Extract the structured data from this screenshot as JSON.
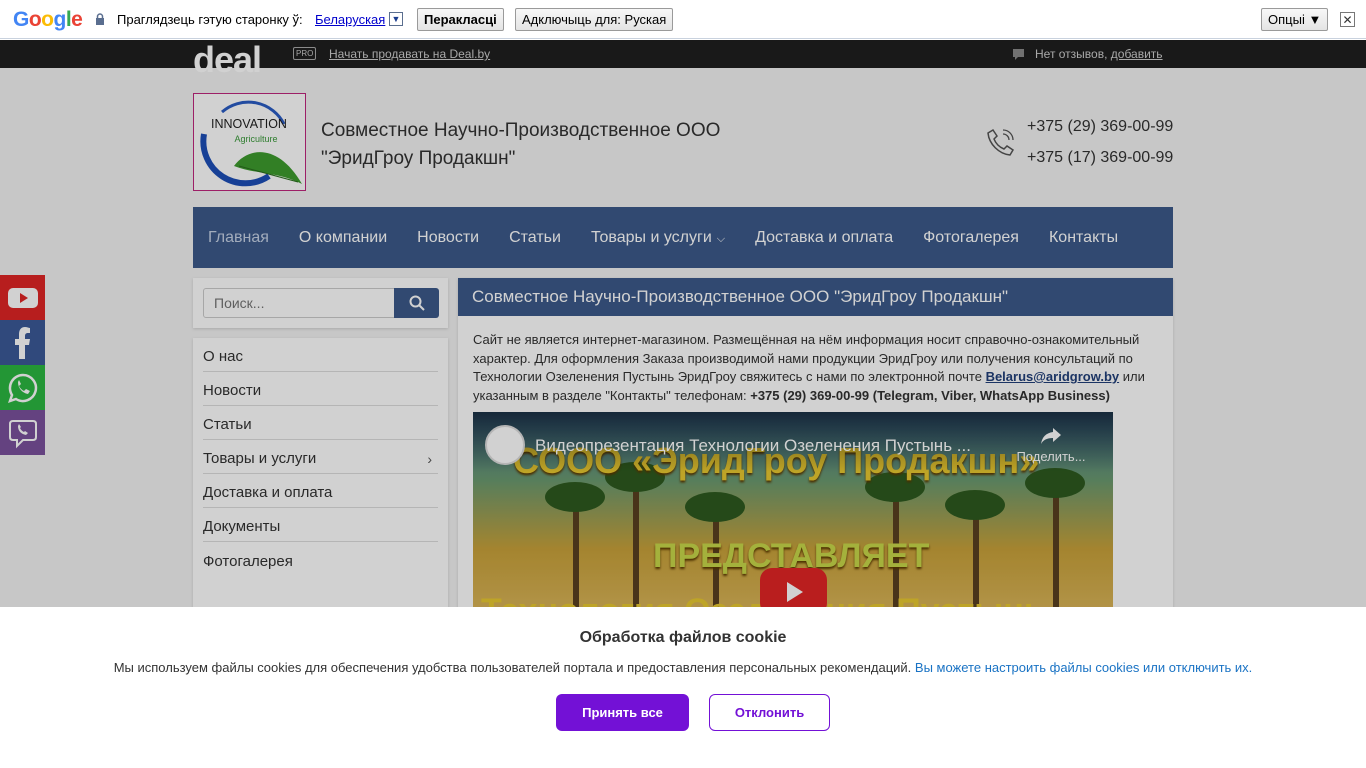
{
  "translate_bar": {
    "logo": "Google",
    "prompt": "Праглядзець гэтую старонку ў:",
    "language": "Беларуская",
    "language_arrow": "▼",
    "translate_button": "Перакласці",
    "disable_button": "Адключыць для: Руская",
    "options_button": "Опцыі ▼",
    "close": "✕"
  },
  "topbar": {
    "logo": "deal",
    "pro_badge": "PRO",
    "sell_link": "Начать продавать на Deal.by",
    "reviews_text": "Нет отзывов, ",
    "reviews_add": "добавить"
  },
  "header": {
    "logo_text_top": "INNOVATION",
    "logo_text_sub": "Agriculture",
    "company_name": "Совместное Научно-Производственное ООО \"ЭридГроу Продакшн\"",
    "phone1": "+375 (29) 369-00-99",
    "phone2": "+375 (17) 369-00-99"
  },
  "nav": {
    "items": [
      {
        "label": "Главная"
      },
      {
        "label": "О компании"
      },
      {
        "label": "Новости"
      },
      {
        "label": "Статьи"
      },
      {
        "label": "Товары и услуги"
      },
      {
        "label": "Доставка и оплата"
      },
      {
        "label": "Фотогалерея"
      },
      {
        "label": "Контакты"
      }
    ]
  },
  "search": {
    "placeholder": "Поиск..."
  },
  "sidebar": {
    "items": [
      {
        "label": "О нас"
      },
      {
        "label": "Новости"
      },
      {
        "label": "Статьи"
      },
      {
        "label": "Товары и услуги"
      },
      {
        "label": "Доставка и оплата"
      },
      {
        "label": "Документы"
      },
      {
        "label": "Фотогалерея"
      }
    ]
  },
  "content": {
    "heading": "Совместное Научно-Производственное ООО \"ЭридГроу Продакшн\"",
    "text_part1": "Сайт не является интернет-магазином. Размещённая на нём информация носит справочно-ознакомительный характер. Для оформления Заказа производимой нами продукции ЭридГроу или получения консультаций по Технологии Озеленения Пустынь ЭридГроу свяжитесь с нами по электронной почте ",
    "email": "Belarus@aridgrow.by",
    "text_part2": " или указанным в разделе \"Контакты\" телефонам: ",
    "phones_bold": "+375 (29) 369-00-99 (Telegram, Viber, WhatsApp Business)",
    "video": {
      "title": "Видеопрезентация Технологии Озеленения Пустынь ...",
      "share": "Поделить...",
      "overlay_line1": "СООО «ЭридГроу Продакшн»",
      "overlay_line2": "ПРЕДСТАВЛЯЕТ",
      "overlay_line3": "Технология Озеленения Пустынь"
    }
  },
  "cookie": {
    "title": "Обработка файлов cookie",
    "text": "Мы используем файлы cookies для обеспечения удобства пользователей портала и предоставления персональных рекомендаций. ",
    "link": "Вы можете настроить файлы cookies или отключить их.",
    "accept": "Принять все",
    "decline": "Отклонить"
  }
}
